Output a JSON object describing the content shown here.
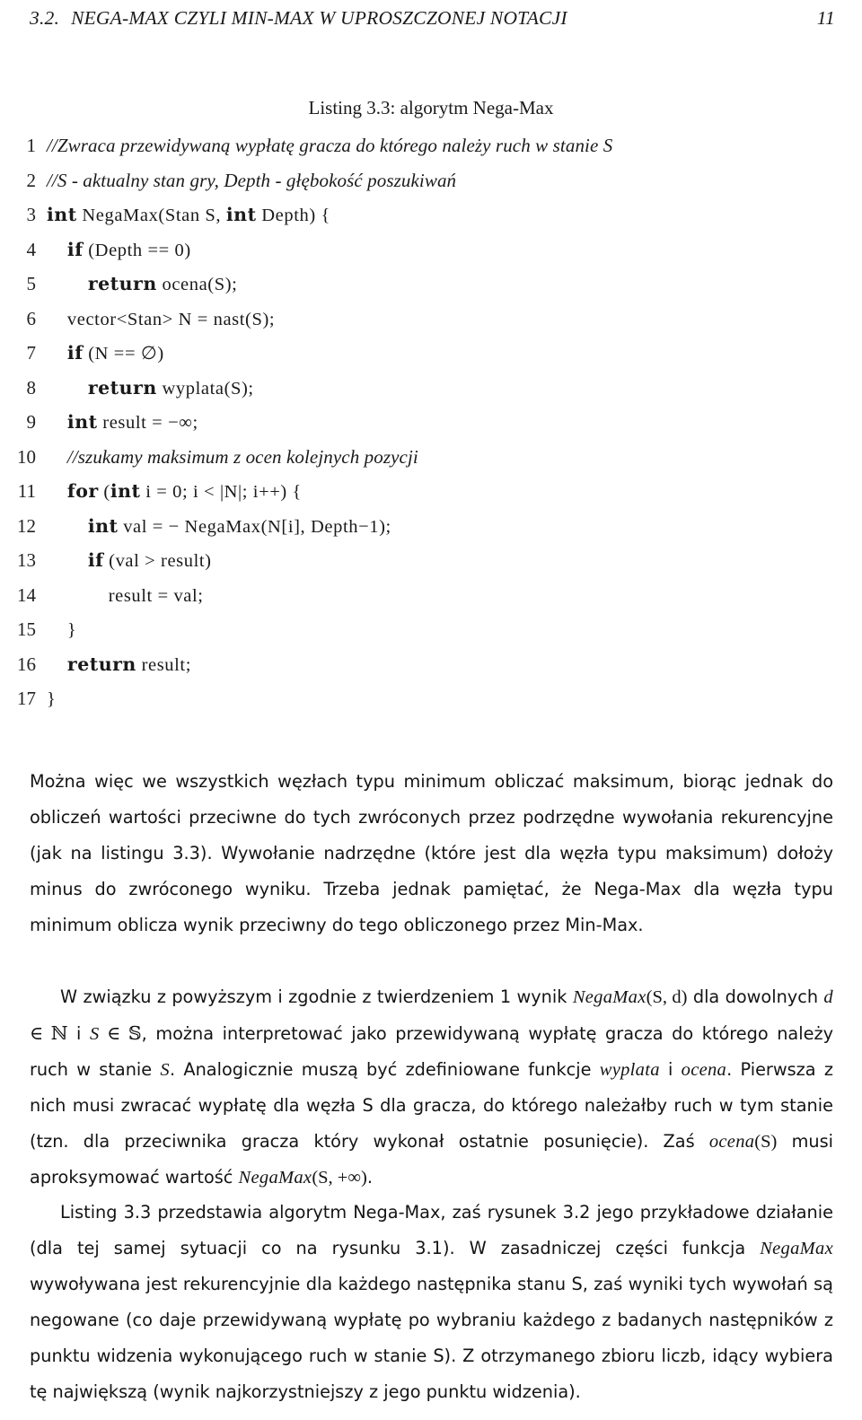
{
  "header": {
    "section_number": "3.2.",
    "section_title": "NEGA-MAX CZYLI MIN-MAX W UPROSZCZONEJ NOTACJI",
    "page_number": "11"
  },
  "listing": {
    "caption": "Listing 3.3: algorytm Nega-Max",
    "lines": [
      {
        "n": "1",
        "text": "//Zwraca przewidywaną wypłatę gracza do którego należy ruch w stanie S"
      },
      {
        "n": "2",
        "text": "//S - aktualny stan gry, Depth - głębokość poszukiwań"
      },
      {
        "n": "3",
        "text": "int NegaMax(Stan S, int Depth) {"
      },
      {
        "n": "4",
        "text": "    if (Depth == 0)"
      },
      {
        "n": "5",
        "text": "        return ocena(S);"
      },
      {
        "n": "6",
        "text": "    vector<Stan> N = nast(S);"
      },
      {
        "n": "7",
        "text": "    if (N == ∅)"
      },
      {
        "n": "8",
        "text": "        return wyplata(S);"
      },
      {
        "n": "9",
        "text": "    int result = −∞;"
      },
      {
        "n": "10",
        "text": "    //szukamy maksimum z ocen kolejnych pozycji"
      },
      {
        "n": "11",
        "text": "    for (int i = 0; i < |N|; i++) {"
      },
      {
        "n": "12",
        "text": "        int val = − NegaMax(N[i], Depth−1);"
      },
      {
        "n": "13",
        "text": "        if (val > result)"
      },
      {
        "n": "14",
        "text": "            result = val;"
      },
      {
        "n": "15",
        "text": "    }"
      },
      {
        "n": "16",
        "text": "    return result;"
      },
      {
        "n": "17",
        "text": "}"
      }
    ]
  },
  "body": {
    "paragraph1": {
      "part1": "Można więc we wszystkich węzłach typu minimum obliczać maksimum, biorąc jednak do obliczeń wartości przeciwne do tych zwróconych przez podrzędne wywołania rekurencyjne (jak na listingu 3.3). Wywołanie nadrzędne (które jest dla węzła typu maksimum) dołoży minus do zwróconego wyniku. Trzeba jednak pamiętać, że Nega-Max dla węzła typu minimum oblicza wynik przeciwny do tego obliczonego przez Min-Max."
    },
    "paragraph2": {
      "s1": "W związku z powyższym i zgodnie z twierdzeniem 1 wynik ",
      "m1": "NegaMax",
      "m1b": "(S, d)",
      "s2": " dla dowolnych ",
      "m2": "d",
      "m2b": " ∈ ",
      "m2c": "ℕ",
      "s3": " i ",
      "m3": "S",
      "m3b": " ∈ ",
      "m3c": "𝕊",
      "s4": ", można interpretować jako przewidywaną wypłatę gracza do którego należy ruch w stanie ",
      "m4": "S",
      "s5": ". Analogicznie muszą być zdefiniowane funkcje ",
      "m5": "wyplata",
      "s6": " i ",
      "m6": "ocena",
      "s7": ". Pierwsza z nich musi zwracać wypłatę dla węzła S dla gracza, do którego należałby ruch w tym stanie (tzn. dla przeciwnika gracza który wykonał ostatnie posunięcie). Zaś ",
      "m7": "ocena",
      "m7b": "(S)",
      "s8": " musi aproksymować wartość ",
      "m8": "NegaMax",
      "m8b": "(S, +∞)",
      "s9": "."
    },
    "paragraph3": {
      "s1": "Listing 3.3 przedstawia algorytm Nega-Max, zaś rysunek 3.2 jego przykładowe działanie (dla tej samej sytuacji co na rysunku 3.1). W zasadniczej części funkcja ",
      "m1": "NegaMax",
      "s2": " wywoływana jest rekurencyjnie dla każdego następnika stanu S, zaś wyniki tych wywołań są negowane (co daje przewidywaną wypłatę po wybraniu każdego z badanych następników z punktu widzenia wykonującego ruch w stanie S). Z otrzymanego zbioru liczb, idący wybiera tę największą (wynik najkorzystniejszy z jego punktu widzenia)."
    }
  },
  "colors": {
    "text": "#1a1a1a",
    "background": "#ffffff"
  }
}
